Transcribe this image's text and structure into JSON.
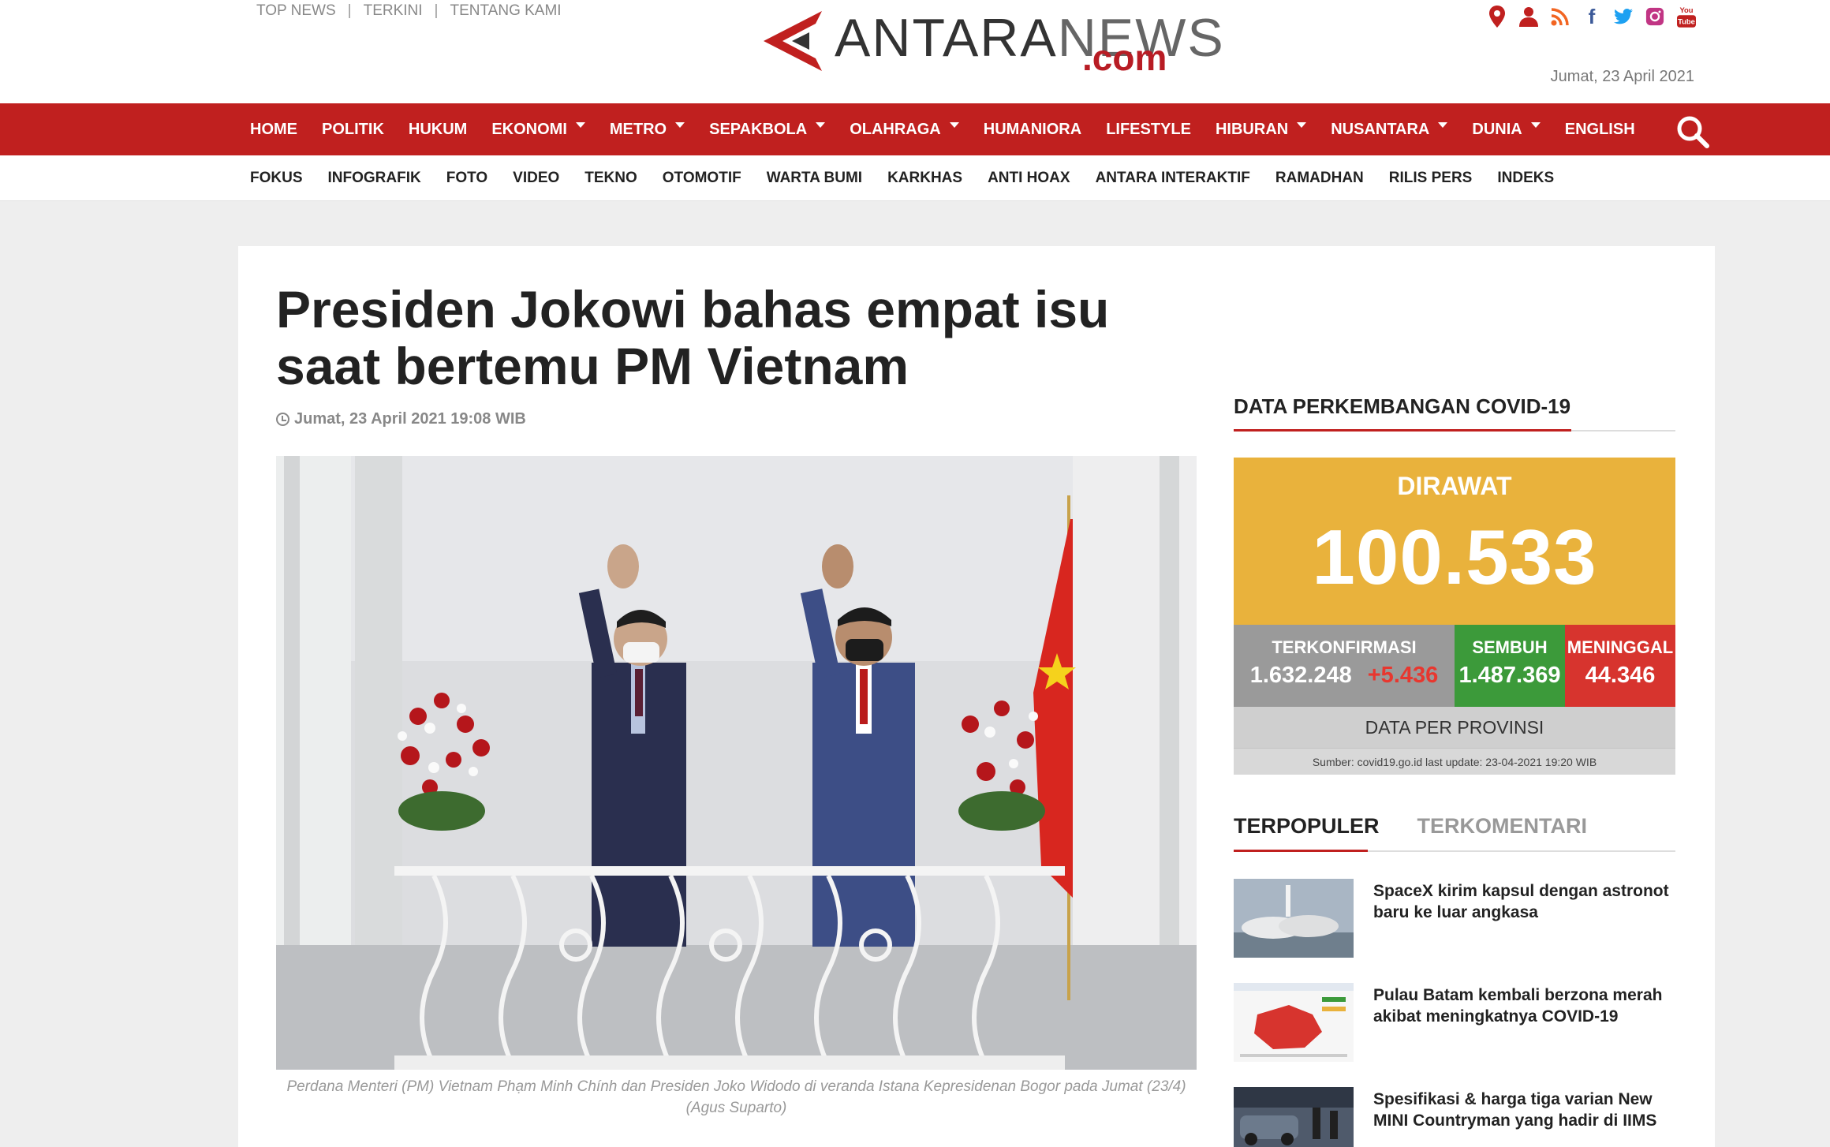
{
  "top_links": [
    "TOP NEWS",
    "TERKINI",
    "TENTANG KAMI"
  ],
  "logo": {
    "text_a": "ANTARA",
    "text_b": "NEWS",
    "text_c": ".com"
  },
  "social_icons": [
    "map-marker-icon",
    "user-icon",
    "rss-icon",
    "facebook-icon",
    "twitter-icon",
    "instagram-icon",
    "youtube-icon"
  ],
  "header_date": "Jumat, 23 April 2021",
  "main_nav": [
    {
      "label": "HOME",
      "dropdown": false
    },
    {
      "label": "POLITIK",
      "dropdown": false
    },
    {
      "label": "HUKUM",
      "dropdown": false
    },
    {
      "label": "EKONOMI",
      "dropdown": true
    },
    {
      "label": "METRO",
      "dropdown": true
    },
    {
      "label": "SEPAKBOLA",
      "dropdown": true
    },
    {
      "label": "OLAHRAGA",
      "dropdown": true
    },
    {
      "label": "HUMANIORA",
      "dropdown": false
    },
    {
      "label": "LIFESTYLE",
      "dropdown": false
    },
    {
      "label": "HIBURAN",
      "dropdown": true
    },
    {
      "label": "NUSANTARA",
      "dropdown": true
    },
    {
      "label": "DUNIA",
      "dropdown": true
    },
    {
      "label": "ENGLISH",
      "dropdown": false
    }
  ],
  "sub_nav": [
    "FOKUS",
    "INFOGRAFIK",
    "FOTO",
    "VIDEO",
    "TEKNO",
    "OTOMOTIF",
    "WARTA BUMI",
    "KARKHAS",
    "ANTI HOAX",
    "ANTARA INTERAKTIF",
    "RAMADHAN",
    "RILIS PERS",
    "INDEKS"
  ],
  "article": {
    "title": "Presiden Jokowi bahas empat isu saat bertemu PM Vietnam",
    "date": "Jumat, 23 April 2021 19:08 WIB",
    "caption": "Perdana Menteri (PM) Vietnam Phạm Minh Chính dan Presiden Joko Widodo di veranda Istana Kepresidenan Bogor pada Jumat (23/4) (Agus Suparto)"
  },
  "covid": {
    "section_title": "DATA PERKEMBANGAN COVID-19",
    "dirawat_label": "DIRAWAT",
    "dirawat_value": "100.533",
    "terkonfirmasi_label": "TERKONFIRMASI",
    "terkonfirmasi_value": "1.632.248",
    "terkonfirmasi_delta": "+5.436",
    "sembuh_label": "SEMBUH",
    "sembuh_value": "1.487.369",
    "meninggal_label": "MENINGGAL",
    "meninggal_value": "44.346",
    "provinsi_label": "DATA PER PROVINSI",
    "source": "Sumber: covid19.go.id last update: 23-04-2021 19:20 WIB",
    "colors": {
      "dirawat": "#e9b23c",
      "terkonfirmasi": "#9a9a9a",
      "sembuh": "#3c9a3a",
      "meninggal": "#d7342e"
    }
  },
  "tabs": {
    "active": "TERPOPULER",
    "inactive": "TERKOMENTARI"
  },
  "popular": [
    {
      "title": "SpaceX kirim kapsul dengan astronot baru ke luar angkasa"
    },
    {
      "title": "Pulau Batam kembali berzona merah akibat meningkatnya COVID-19"
    },
    {
      "title": "Spesifikasi & harga tiga varian New MINI Countryman yang hadir di IIMS"
    }
  ],
  "brand_color": "#c0201f"
}
